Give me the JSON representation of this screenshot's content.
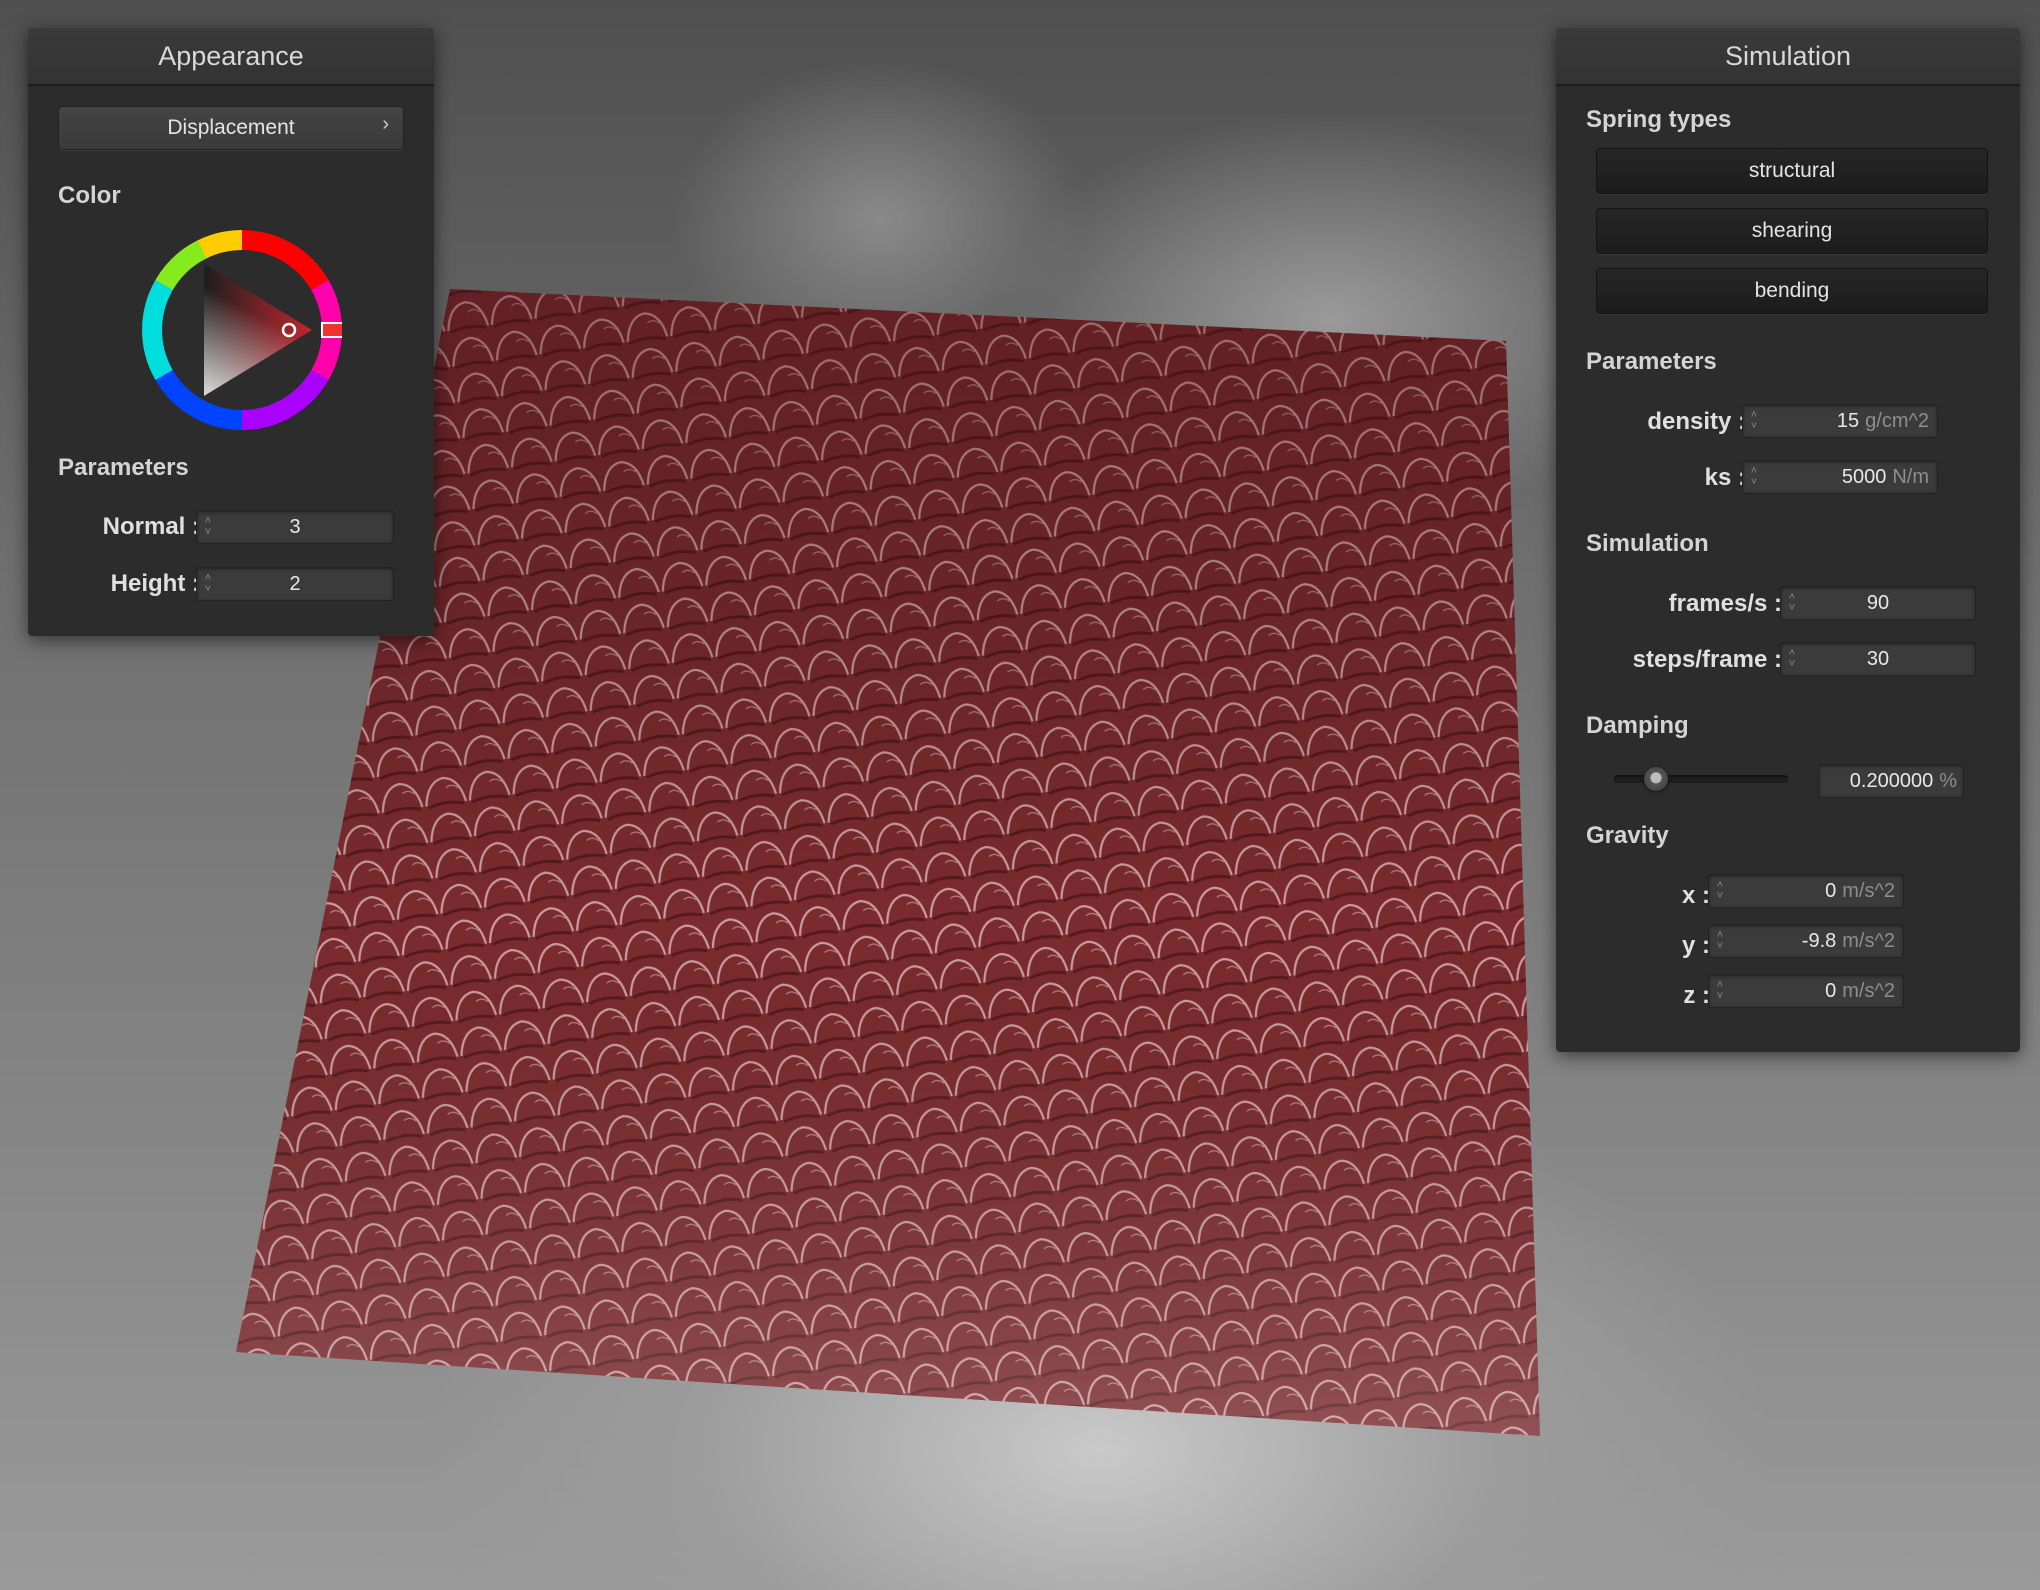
{
  "appearance": {
    "title": "Appearance",
    "mode_button": "Displacement",
    "mode_chevron": "›",
    "color_label": "Color",
    "params_label": "Parameters",
    "normal_label": "Normal :",
    "normal_value": "3",
    "height_label": "Height :",
    "height_value": "2",
    "selected_color": "#7a2a2e"
  },
  "simulation": {
    "title": "Simulation",
    "spring_types_label": "Spring types",
    "spring_buttons": [
      "structural",
      "shearing",
      "bending"
    ],
    "params_label": "Parameters",
    "density_label": "density :",
    "density_value": "15",
    "density_unit": "g/cm^2",
    "ks_label": "ks :",
    "ks_value": "5000",
    "ks_unit": "N/m",
    "sim_label": "Simulation",
    "fps_label": "frames/s :",
    "fps_value": "90",
    "steps_label": "steps/frame :",
    "steps_value": "30",
    "damping_label": "Damping",
    "damping_value": "0.200000",
    "damping_unit": "%",
    "damping_slider_level": 0.2,
    "gravity_label": "Gravity",
    "gx_label": "x :",
    "gx_value": "0",
    "gy_label": "y :",
    "gy_value": "-9.8",
    "gz_label": "z :",
    "gz_value": "0",
    "gravity_unit": "m/s^2"
  },
  "colors": {
    "cloth": "#7a2a2e",
    "panel_bg": "#2c2c2c"
  }
}
